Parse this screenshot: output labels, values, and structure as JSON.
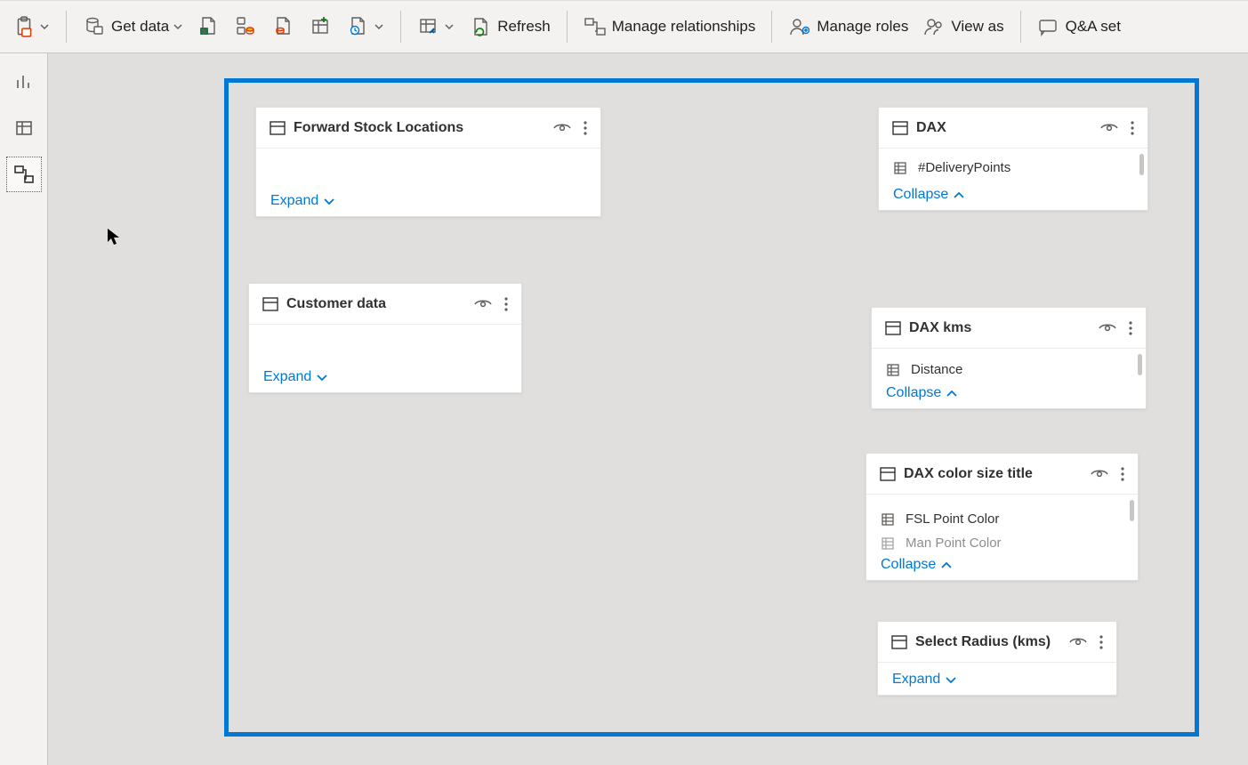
{
  "toolbar": {
    "get_data": "Get data",
    "refresh": "Refresh",
    "manage_relationships": "Manage relationships",
    "manage_roles": "Manage roles",
    "view_as": "View as",
    "qa_setup": "Q&A set"
  },
  "labels": {
    "expand": "Expand",
    "collapse": "Collapse"
  },
  "tables": {
    "fsl": {
      "title": "Forward Stock Locations"
    },
    "customer": {
      "title": "Customer data"
    },
    "dax": {
      "title": "DAX",
      "fields": [
        "#DeliveryPoints"
      ]
    },
    "dax_kms": {
      "title": "DAX kms",
      "fields": [
        "Distance"
      ]
    },
    "dax_color": {
      "title": "DAX color size title",
      "fields": [
        "FSL Point Color",
        "Man Point Color"
      ]
    },
    "select_radius": {
      "title": "Select Radius (kms)"
    }
  }
}
